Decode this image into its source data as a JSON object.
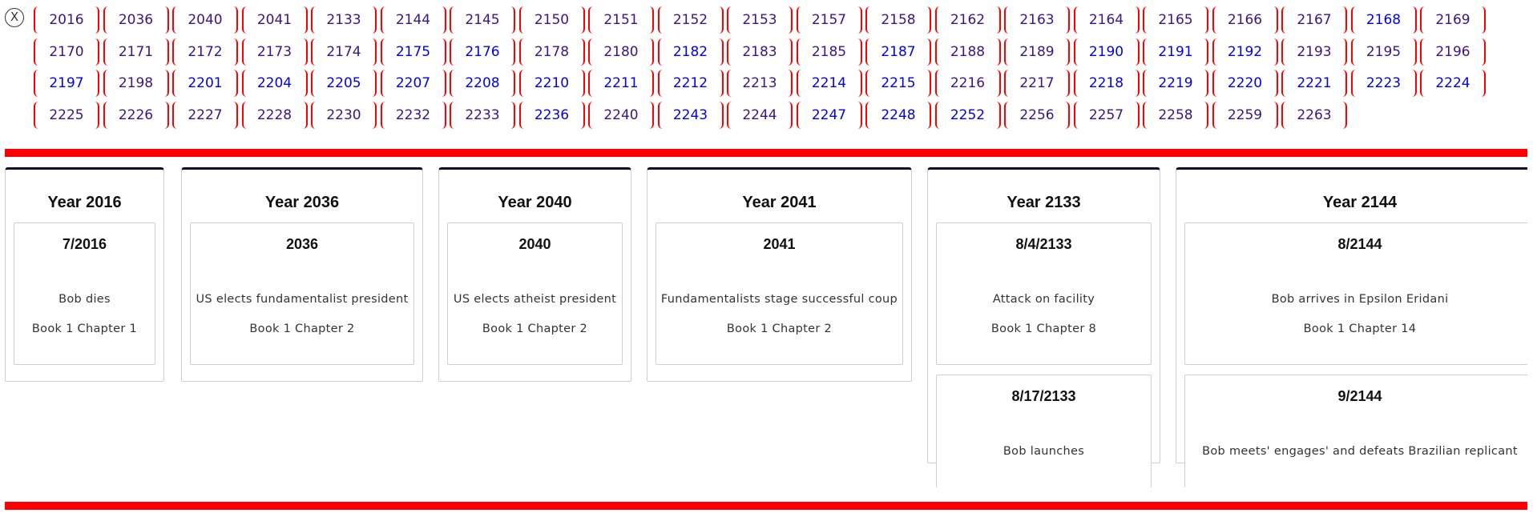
{
  "close_label": "X",
  "nav": {
    "rows": [
      [
        {
          "label": "2016",
          "linked": false
        },
        {
          "label": "2036",
          "linked": false
        },
        {
          "label": "2040",
          "linked": false
        },
        {
          "label": "2041",
          "linked": false
        },
        {
          "label": "2133",
          "linked": false
        },
        {
          "label": "2144",
          "linked": false
        },
        {
          "label": "2145",
          "linked": false
        },
        {
          "label": "2150",
          "linked": false
        },
        {
          "label": "2151",
          "linked": false
        },
        {
          "label": "2152",
          "linked": false
        },
        {
          "label": "2153",
          "linked": false
        },
        {
          "label": "2157",
          "linked": false
        },
        {
          "label": "2158",
          "linked": false
        },
        {
          "label": "2162",
          "linked": false
        },
        {
          "label": "2163",
          "linked": false
        },
        {
          "label": "2164",
          "linked": false
        },
        {
          "label": "2165",
          "linked": false
        },
        {
          "label": "2166",
          "linked": false
        },
        {
          "label": "2167",
          "linked": false
        },
        {
          "label": "2168",
          "linked": true
        },
        {
          "label": "2169",
          "linked": false
        }
      ],
      [
        {
          "label": "2170",
          "linked": false
        },
        {
          "label": "2171",
          "linked": false
        },
        {
          "label": "2172",
          "linked": false
        },
        {
          "label": "2173",
          "linked": false
        },
        {
          "label": "2174",
          "linked": false
        },
        {
          "label": "2175",
          "linked": true
        },
        {
          "label": "2176",
          "linked": true
        },
        {
          "label": "2178",
          "linked": false
        },
        {
          "label": "2180",
          "linked": false
        },
        {
          "label": "2182",
          "linked": true
        },
        {
          "label": "2183",
          "linked": false
        },
        {
          "label": "2185",
          "linked": false
        },
        {
          "label": "2187",
          "linked": true
        },
        {
          "label": "2188",
          "linked": false
        },
        {
          "label": "2189",
          "linked": false
        },
        {
          "label": "2190",
          "linked": true
        },
        {
          "label": "2191",
          "linked": true
        },
        {
          "label": "2192",
          "linked": true
        },
        {
          "label": "2193",
          "linked": false
        },
        {
          "label": "2195",
          "linked": false
        },
        {
          "label": "2196",
          "linked": false
        }
      ],
      [
        {
          "label": "2197",
          "linked": true
        },
        {
          "label": "2198",
          "linked": false
        },
        {
          "label": "2201",
          "linked": true
        },
        {
          "label": "2204",
          "linked": true
        },
        {
          "label": "2205",
          "linked": true
        },
        {
          "label": "2207",
          "linked": true
        },
        {
          "label": "2208",
          "linked": true
        },
        {
          "label": "2210",
          "linked": true
        },
        {
          "label": "2211",
          "linked": true
        },
        {
          "label": "2212",
          "linked": true
        },
        {
          "label": "2213",
          "linked": false
        },
        {
          "label": "2214",
          "linked": true
        },
        {
          "label": "2215",
          "linked": true
        },
        {
          "label": "2216",
          "linked": false
        },
        {
          "label": "2217",
          "linked": false
        },
        {
          "label": "2218",
          "linked": true
        },
        {
          "label": "2219",
          "linked": true
        },
        {
          "label": "2220",
          "linked": true
        },
        {
          "label": "2221",
          "linked": true
        },
        {
          "label": "2223",
          "linked": true
        },
        {
          "label": "2224",
          "linked": true
        }
      ],
      [
        {
          "label": "2225",
          "linked": false
        },
        {
          "label": "2226",
          "linked": false
        },
        {
          "label": "2227",
          "linked": false
        },
        {
          "label": "2228",
          "linked": false
        },
        {
          "label": "2230",
          "linked": false
        },
        {
          "label": "2232",
          "linked": false
        },
        {
          "label": "2233",
          "linked": false
        },
        {
          "label": "2236",
          "linked": true
        },
        {
          "label": "2240",
          "linked": false
        },
        {
          "label": "2243",
          "linked": true
        },
        {
          "label": "2244",
          "linked": false
        },
        {
          "label": "2247",
          "linked": true
        },
        {
          "label": "2248",
          "linked": true
        },
        {
          "label": "2252",
          "linked": true
        },
        {
          "label": "2256",
          "linked": false
        },
        {
          "label": "2257",
          "linked": false
        },
        {
          "label": "2258",
          "linked": false
        },
        {
          "label": "2259",
          "linked": false
        },
        {
          "label": "2263",
          "linked": false
        }
      ]
    ]
  },
  "timeline": [
    {
      "title": "Year 2016",
      "events": [
        {
          "date": "7/2016",
          "description": "Bob dies",
          "ref": "Book 1 Chapter 1"
        }
      ]
    },
    {
      "title": "Year 2036",
      "events": [
        {
          "date": "2036",
          "description": "US elects fundamentalist president",
          "ref": "Book 1 Chapter 2"
        }
      ]
    },
    {
      "title": "Year 2040",
      "events": [
        {
          "date": "2040",
          "description": "US elects atheist president",
          "ref": "Book 1 Chapter 2"
        }
      ]
    },
    {
      "title": "Year 2041",
      "events": [
        {
          "date": "2041",
          "description": "Fundamentalists stage successful coup",
          "ref": "Book 1 Chapter 2"
        }
      ]
    },
    {
      "title": "Year 2133",
      "events": [
        {
          "date": "8/4/2133",
          "description": "Attack on facility",
          "ref": "Book 1 Chapter 8"
        },
        {
          "date": "8/17/2133",
          "description": "Bob launches",
          "ref": ""
        }
      ]
    },
    {
      "title": "Year 2144",
      "events": [
        {
          "date": "8/2144",
          "description": "Bob arrives in Epsilon Eridani",
          "ref": "Book 1 Chapter 14"
        },
        {
          "date": "9/2144",
          "description": "Bob meets' engages' and defeats Brazilian replicant",
          "ref": ""
        }
      ]
    }
  ]
}
